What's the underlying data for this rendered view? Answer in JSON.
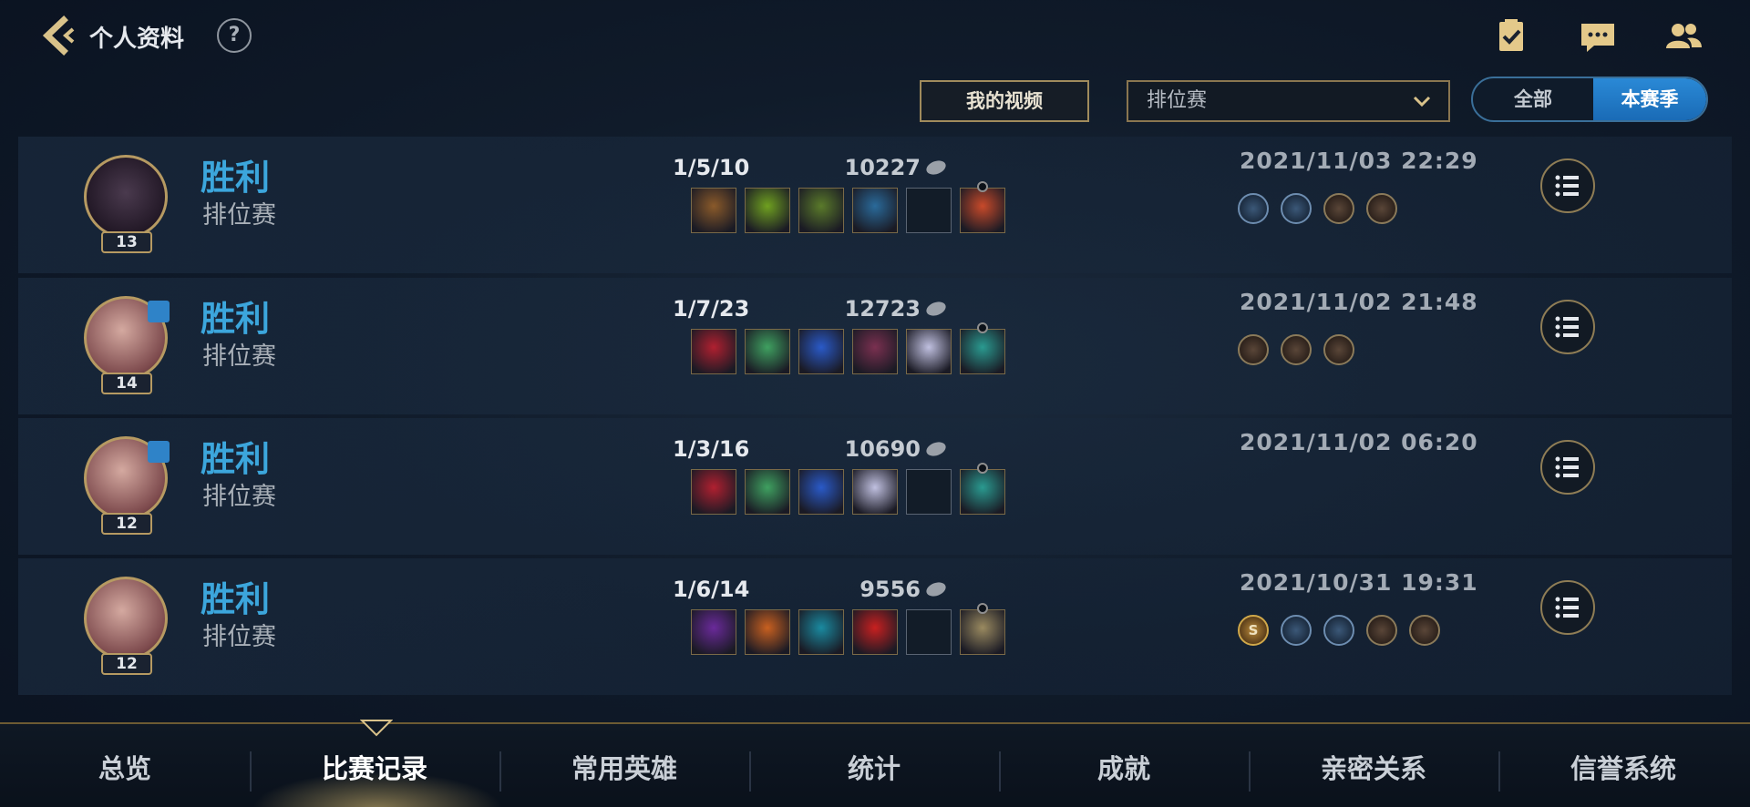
{
  "header": {
    "title": "个人资料",
    "help_label": "?"
  },
  "filters": {
    "videos_button": "我的视频",
    "mode_select": "排位赛",
    "season_toggle": {
      "all": "全部",
      "season": "本赛季",
      "selected": "本赛季"
    }
  },
  "matches": [
    {
      "result": "胜利",
      "mode": "排位赛",
      "level": "13",
      "kda": "1/5/10",
      "gold": "10227",
      "datetime": "2021/11/03 22:29",
      "items_filled": [
        true,
        true,
        true,
        true,
        false,
        true
      ],
      "medals": [
        "blue",
        "blue",
        "bronze",
        "bronze"
      ]
    },
    {
      "result": "胜利",
      "mode": "排位赛",
      "level": "14",
      "kda": "1/7/23",
      "gold": "12723",
      "datetime": "2021/11/02 21:48",
      "items_filled": [
        true,
        true,
        true,
        true,
        true,
        true
      ],
      "medals": [
        "bronze",
        "bronze",
        "bronze"
      ]
    },
    {
      "result": "胜利",
      "mode": "排位赛",
      "level": "12",
      "kda": "1/3/16",
      "gold": "10690",
      "datetime": "2021/11/02 06:20",
      "items_filled": [
        true,
        true,
        true,
        true,
        false,
        true
      ],
      "medals": []
    },
    {
      "result": "胜利",
      "mode": "排位赛",
      "level": "12",
      "kda": "1/6/14",
      "gold": "9556",
      "datetime": "2021/10/31 19:31",
      "items_filled": [
        true,
        true,
        true,
        true,
        false,
        true
      ],
      "medals": [
        "gold-s",
        "blue",
        "blue",
        "bronze",
        "bronze"
      ]
    }
  ],
  "medal_glyph": {
    "gold-s": "S",
    "blue": "",
    "bronze": ""
  },
  "nav": {
    "tabs": [
      "总览",
      "比赛记录",
      "常用英雄",
      "统计",
      "成就",
      "亲密关系",
      "信誉系统"
    ],
    "active_index": 1
  },
  "colors": {
    "accent_blue": "#3ca6dc",
    "gold_border": "#b69a62",
    "active_toggle": "#1f7dc9"
  }
}
